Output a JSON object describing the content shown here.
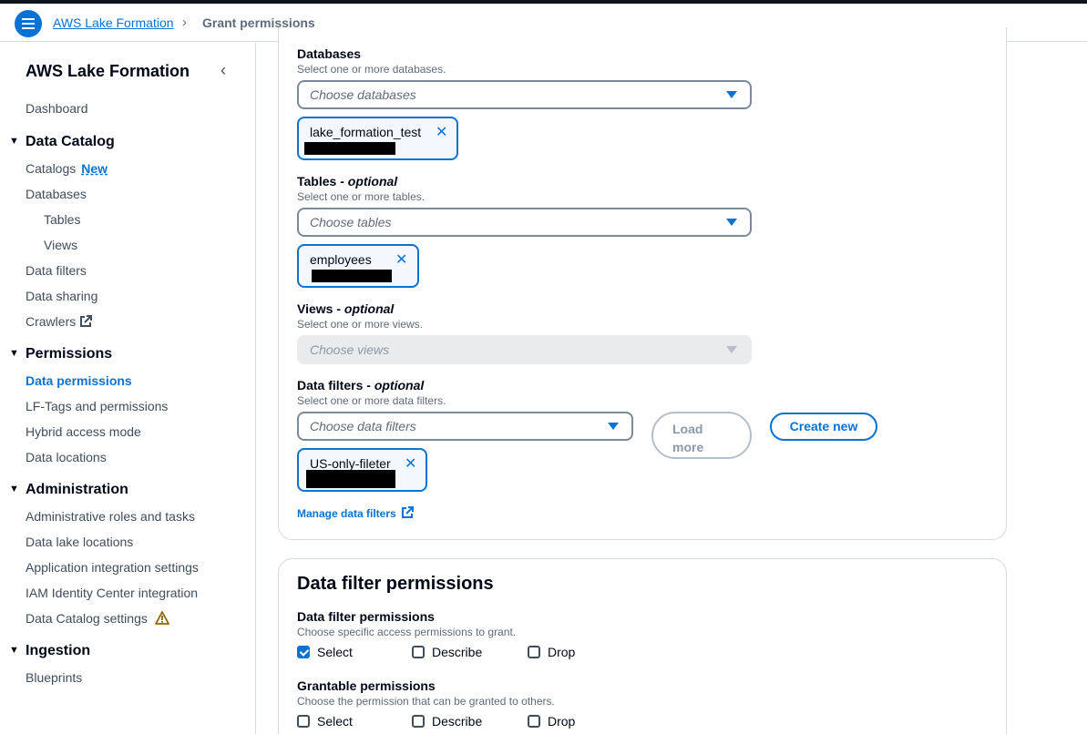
{
  "header": {
    "breadcrumb_root": "AWS Lake Formation",
    "breadcrumb_current": "Grant permissions"
  },
  "sidebar": {
    "title": "AWS Lake Formation",
    "dashboard": "Dashboard",
    "data_catalog": {
      "heading": "Data Catalog",
      "catalogs": "Catalogs",
      "catalogs_badge": "New",
      "databases": "Databases",
      "tables": "Tables",
      "views": "Views",
      "data_filters": "Data filters",
      "data_sharing": "Data sharing",
      "crawlers": "Crawlers"
    },
    "permissions": {
      "heading": "Permissions",
      "data_permissions": "Data permissions",
      "lf_tags": "LF-Tags and permissions",
      "hybrid": "Hybrid access mode",
      "data_locations": "Data locations"
    },
    "administration": {
      "heading": "Administration",
      "admin_roles": "Administrative roles and tasks",
      "lake_locations": "Data lake locations",
      "app_integration": "Application integration settings",
      "iam_identity": "IAM Identity Center integration",
      "catalog_settings": "Data Catalog settings"
    },
    "ingestion": {
      "heading": "Ingestion",
      "blueprints": "Blueprints"
    }
  },
  "form": {
    "databases": {
      "label": "Databases",
      "desc": "Select one or more databases.",
      "placeholder": "Choose databases",
      "token": "lake_formation_test"
    },
    "tables": {
      "label": "Tables - ",
      "optional": "optional",
      "desc": "Select one or more tables.",
      "placeholder": "Choose tables",
      "token": "employees"
    },
    "views": {
      "label": "Views - ",
      "optional": "optional",
      "desc": "Select one or more views.",
      "placeholder": "Choose views"
    },
    "data_filters": {
      "label": "Data filters - ",
      "optional": "optional",
      "desc": "Select one or more data filters.",
      "placeholder": "Choose data filters",
      "load_more_1": "Load",
      "load_more_2": "more",
      "create_new": "Create new",
      "token": "US-only-fileter"
    },
    "manage_link": "Manage data filters"
  },
  "filter_permissions": {
    "title": "Data filter permissions",
    "perm_label": "Data filter permissions",
    "perm_desc": "Choose specific access permissions to grant.",
    "grant_label": "Grantable permissions",
    "grant_desc": "Choose the permission that can be granted to others.",
    "opt_select": "Select",
    "opt_describe": "Describe",
    "opt_drop": "Drop"
  }
}
